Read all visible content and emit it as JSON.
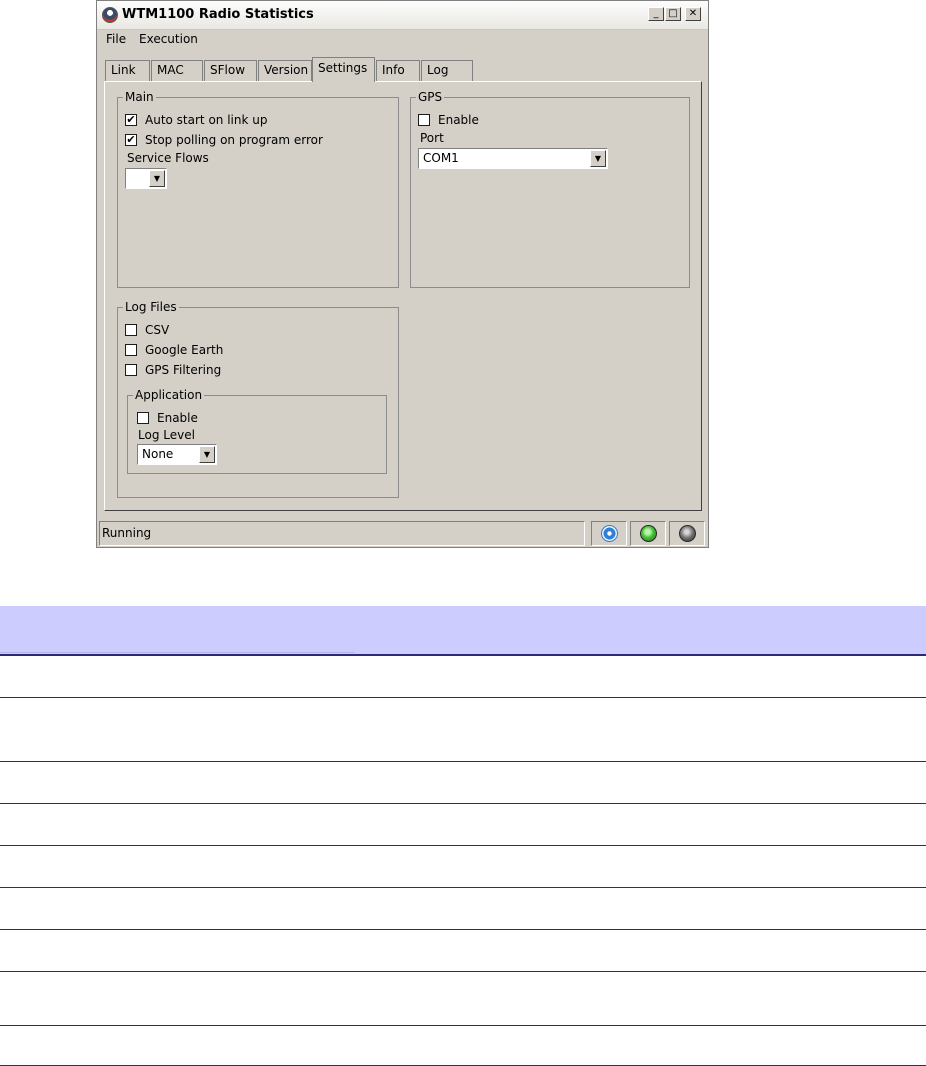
{
  "window": {
    "title": "WTM1100 Radio Statistics",
    "controls": {
      "minimize": "_",
      "maximize": "□",
      "close": "✕"
    }
  },
  "menu": {
    "file": "File",
    "execution": "Execution"
  },
  "tabs": [
    {
      "label": "Link"
    },
    {
      "label": "MAC"
    },
    {
      "label": "SFlow"
    },
    {
      "label": "Version"
    },
    {
      "label": "Settings"
    },
    {
      "label": "Info"
    },
    {
      "label": "Log"
    }
  ],
  "active_tab": "Settings",
  "main_group": {
    "title": "Main",
    "auto_start": {
      "label": "Auto start on link up",
      "checked": true
    },
    "stop_polling": {
      "label": "Stop polling on program error",
      "checked": true
    },
    "service_flows_label": "Service Flows",
    "service_flows_value": ""
  },
  "gps_group": {
    "title": "GPS",
    "enable": {
      "label": "Enable",
      "checked": false
    },
    "port_label": "Port",
    "port_value": "COM1"
  },
  "log_files_group": {
    "title": "Log Files",
    "csv": {
      "label": "CSV",
      "checked": false
    },
    "google_earth": {
      "label": "Google Earth",
      "checked": false
    },
    "gps_filtering": {
      "label": "GPS Filtering",
      "checked": false
    },
    "application": {
      "title": "Application",
      "enable": {
        "label": "Enable",
        "checked": false
      },
      "log_level_label": "Log Level",
      "log_level_value": "None"
    }
  },
  "status_bar": {
    "text": "Running",
    "icons": [
      "stop-icon",
      "green-led-icon",
      "gray-led-icon"
    ],
    "colors": {
      "stop": "#2f7fd6",
      "green": "#47c23a",
      "gray": "#6f6f6f"
    }
  },
  "check_mark": "✔",
  "dropdown_arrow": "▼"
}
